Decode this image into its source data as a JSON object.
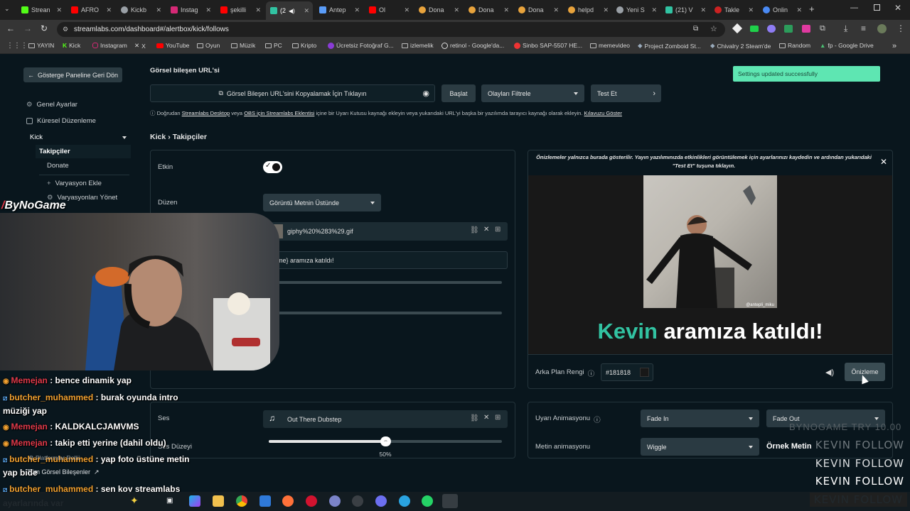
{
  "tabs": [
    {
      "label": "Strean",
      "color": "#53fc18"
    },
    {
      "label": "AFRO",
      "color": "#ff0000"
    },
    {
      "label": "Kickb",
      "color": "#9aa0a6"
    },
    {
      "label": "Instag",
      "color": "#d62976"
    },
    {
      "label": "şekilli",
      "color": "#ff0000"
    },
    {
      "label": "(2",
      "color": "#31c3a2"
    },
    {
      "label": "Antep",
      "color": "#5a9cf8"
    },
    {
      "label": "Ol",
      "color": "#ff0000"
    },
    {
      "label": "Dona",
      "color": "#e8a33c"
    },
    {
      "label": "Dona",
      "color": "#e8a33c"
    },
    {
      "label": "Dona",
      "color": "#e8a33c"
    },
    {
      "label": "helpd",
      "color": "#e8a33c"
    },
    {
      "label": "Yeni S",
      "color": "#9aa0a6"
    },
    {
      "label": "(21) V",
      "color": "#31c3a2"
    },
    {
      "label": "Takle",
      "color": "#cc2222"
    },
    {
      "label": "Onlin",
      "color": "#4a8af4"
    }
  ],
  "address": {
    "url": "streamlabs.com/dashboard#/alertbox/kick/follows"
  },
  "bookmarks": [
    "YAYIN",
    "Kick",
    "Instagram",
    "X",
    "YouTube",
    "Oyun",
    "Müzik",
    "PC",
    "Kripto",
    "Ücretsiz Fotoğraf G...",
    "izlemelik",
    "retinol - Google'da...",
    "Sinbo SAP-5507 HE...",
    "memevideo",
    "Project Zomboid St...",
    "Chivalry 2 Steam'de",
    "Random",
    "fp - Google Drive"
  ],
  "sidebar": {
    "back_label": "Gösterge Paneline Geri Dön",
    "general": "Genel Ayarlar",
    "global": "Küresel Düzenleme",
    "platform": "Kick",
    "followers": "Takipçiler",
    "donate": "Donate",
    "add_variation": "Varyasyon Ekle",
    "manage_variations": "Varyasyonları Yönet",
    "all_widgets": "Tüm Görsel Bileşenler"
  },
  "header": {
    "url_title": "Görsel bileşen URL'si",
    "copy_label": "Görsel Bileşen URL'sini Kopyalamak İçin Tıklayın",
    "start_button": "Başlat",
    "filter_label": "Olayları Filtrele",
    "test_label": "Test Et",
    "toast": "Settings updated successfully",
    "info_prefix": "Doğrudan",
    "info_link1": "Streamlabs Desktop",
    "info_mid1": "veya",
    "info_link2": "OBS için Streamlabs Eklentisi",
    "info_mid2": "içine bir Uyarı Kutusu kaynağı ekleyin veya yukarıdaki URL'yi başka bir yazılımda tarayıcı kaynağı olarak ekleyin.",
    "info_link3": "Kılavuzu Göster"
  },
  "breadcrumb": {
    "root": "Kick",
    "sep": "›",
    "current": "Takipçiler"
  },
  "settings": {
    "enabled_label": "Etkin",
    "layout_label": "Düzen",
    "layout_value": "Görüntü Metnin Üstünde",
    "file_name": "giphy%20%283%29.gif",
    "message_text": "me} aramıza katıldı!",
    "sound_label": "Ses",
    "sound_value": "Out There Dubstep",
    "volume_label": "Ses Düzeyi",
    "volume_value": "50%",
    "volume_fraction": 0.5
  },
  "preview": {
    "notice": "Önizlemeler yalnızca burada gösterilir. Yayın yazılımınızda etkinlikleri görüntülemek için ayarlarınızı kaydedin ve ardından yukarıdaki \"Test Et\" tuşuna tıklayın.",
    "gif_watermark": "@antepli_miku",
    "name": "Kevin",
    "message": "aramıza katıldı!",
    "name_color": "#32c3a2",
    "bg_label": "Arka Plan Rengi",
    "bg_value": "#181818",
    "preview_button": "Önizleme"
  },
  "animation": {
    "alert_label": "Uyarı Animasyonu",
    "in_value": "Fade In",
    "out_value": "Fade Out",
    "text_label": "Metin animasyonu",
    "text_value": "Wiggle",
    "sample_label": "Örnek Metin"
  },
  "overlay": {
    "logo": "ByNoGame",
    "chat": [
      {
        "user": "Memejan",
        "text": ": bence dinamik yap",
        "badge": "red"
      },
      {
        "user": "butcher_muhammed",
        "text": ": burak oyunda intro",
        "badge": "orange"
      },
      {
        "user": "",
        "text": "müziği yap",
        "badge": ""
      },
      {
        "user": "Memejan",
        "text": ": KALDKALCJAMVMS",
        "badge": "red"
      },
      {
        "user": "Memejan",
        "text": ": takip etti yerine (dahil oldu)",
        "badge": "red"
      },
      {
        "user": "butcher_muhammed",
        "text": ": yap foto üstüne metin",
        "badge": "orange"
      },
      {
        "user": "",
        "text": "yap bide",
        "badge": ""
      },
      {
        "user": "butcher_muhammed",
        "text": ": sen koy streamlabs",
        "badge": "orange"
      },
      {
        "user": "",
        "text": "ayarlarında var",
        "badge": ""
      }
    ],
    "ticker": "BYNOGAME  TRY 10.00",
    "follows": [
      "KEVIN  FOLLOW",
      "KEVIN  FOLLOW",
      "KEVIN  FOLLOW",
      "KEVIN  FOLLOW"
    ],
    "follow_highlight": "#e36a10"
  }
}
